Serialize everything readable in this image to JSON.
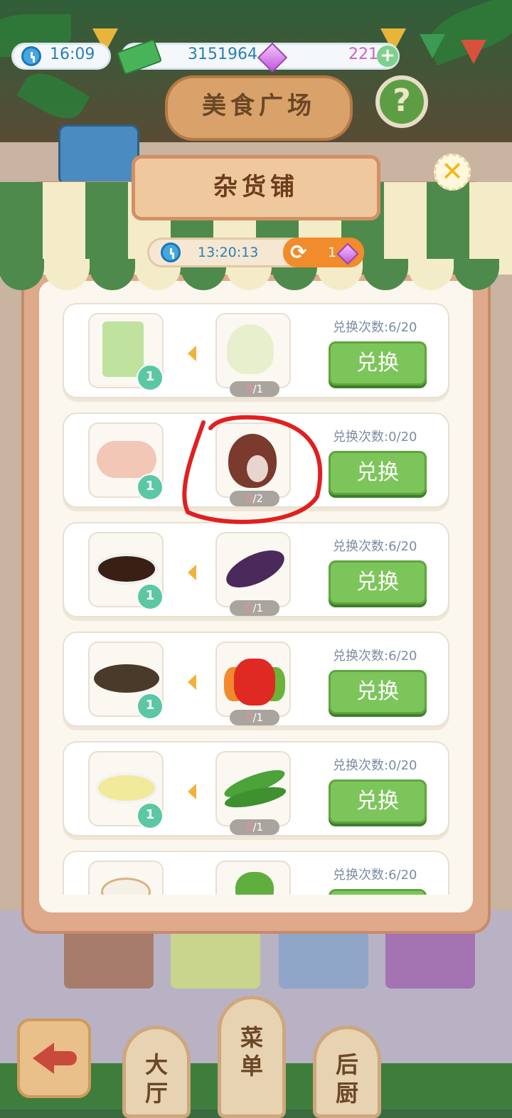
{
  "status_bar": {
    "time": "16:09",
    "money": "3151964",
    "gems": "221"
  },
  "header": {
    "plaza_sign": "美食广场",
    "help": "?"
  },
  "shop": {
    "title": "杂货铺",
    "timer": "13:20:13",
    "refresh_cost": "1",
    "close": "✕"
  },
  "trades": [
    {
      "give_item": "rice-noodles",
      "give_qty": "1",
      "get_item": "garlic",
      "have": "0",
      "need": "/1",
      "count_label": "兑换次数:6/20",
      "button": "兑换"
    },
    {
      "give_item": "raw-chicken",
      "give_qty": "1",
      "get_item": "ham",
      "have": "0",
      "need": "/2",
      "count_label": "兑换次数:0/20",
      "button": "兑换"
    },
    {
      "give_item": "soy-sauce",
      "give_qty": "1",
      "get_item": "eggplant",
      "have": "0",
      "need": "/1",
      "count_label": "兑换次数:6/20",
      "button": "兑换"
    },
    {
      "give_item": "peppercorns",
      "give_qty": "1",
      "get_item": "bell-pepper",
      "have": "0",
      "need": "/1",
      "count_label": "兑换次数:6/20",
      "button": "兑换"
    },
    {
      "give_item": "minced-garlic",
      "give_qty": "1",
      "get_item": "green-beans",
      "have": "0",
      "need": "/1",
      "count_label": "兑换次数:0/20",
      "button": "兑换"
    },
    {
      "give_item": "rice",
      "give_qty": "",
      "get_item": "broccoli",
      "have": "",
      "need": "",
      "count_label": "兑换次数:6/20",
      "button": ""
    }
  ],
  "nav": {
    "hall": "大\n厅",
    "menu": "菜\n单",
    "kitchen": "后\n厨"
  },
  "colors": {
    "button_green": "#7cc55a",
    "panel": "#dfa98c",
    "annotation_red": "#e02020"
  }
}
